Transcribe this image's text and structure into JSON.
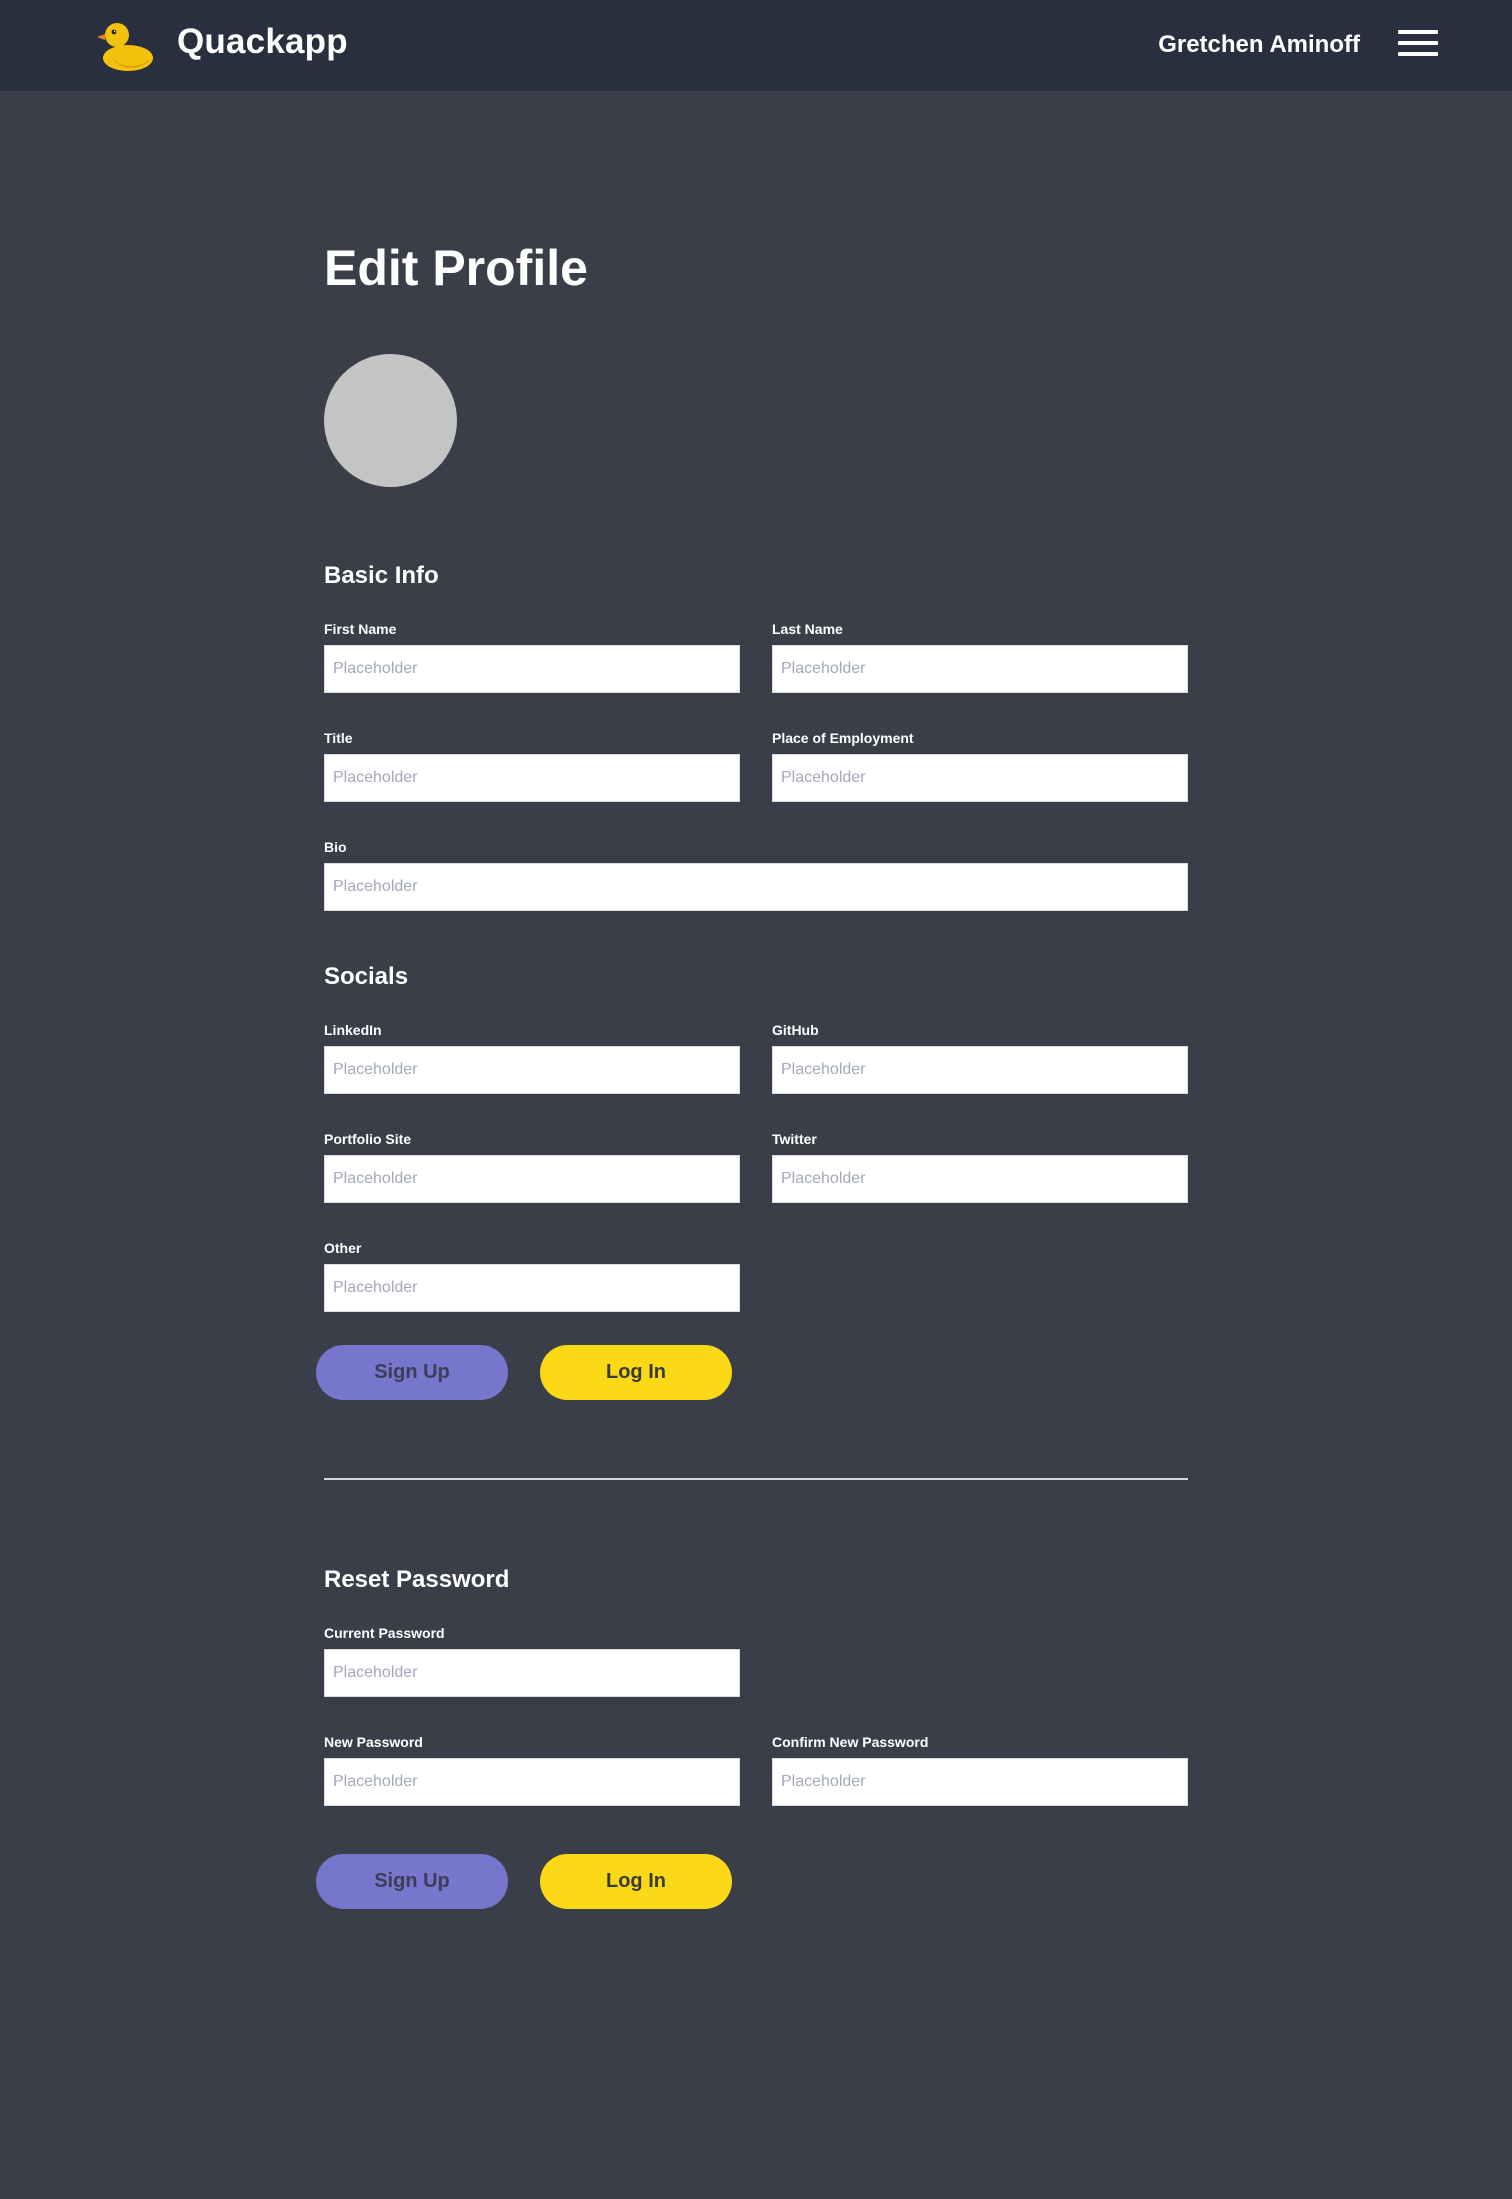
{
  "header": {
    "app_name": "Quackapp",
    "user_name": "Gretchen Aminoff",
    "logo_icon": "duck-icon",
    "menu_icon": "hamburger-menu-icon"
  },
  "page": {
    "title": "Edit Profile"
  },
  "basic_info": {
    "heading": "Basic Info",
    "first_name": {
      "label": "First Name",
      "placeholder": "Placeholder",
      "value": ""
    },
    "last_name": {
      "label": "Last Name",
      "placeholder": "Placeholder",
      "value": ""
    },
    "title": {
      "label": "Title",
      "placeholder": "Placeholder",
      "value": ""
    },
    "employment": {
      "label": "Place of Employment",
      "placeholder": "Placeholder",
      "value": ""
    },
    "bio": {
      "label": "Bio",
      "placeholder": "Placeholder",
      "value": ""
    }
  },
  "socials": {
    "heading": "Socials",
    "linkedin": {
      "label": "LinkedIn",
      "placeholder": "Placeholder",
      "value": ""
    },
    "github": {
      "label": "GitHub",
      "placeholder": "Placeholder",
      "value": ""
    },
    "portfolio": {
      "label": "Portfolio Site",
      "placeholder": "Placeholder",
      "value": ""
    },
    "twitter": {
      "label": "Twitter",
      "placeholder": "Placeholder",
      "value": ""
    },
    "other": {
      "label": "Other",
      "placeholder": "Placeholder",
      "value": ""
    }
  },
  "profile_actions": {
    "signup_label": "Sign Up",
    "login_label": "Log In"
  },
  "reset_password": {
    "heading": "Reset Password",
    "current": {
      "label": "Current Password",
      "placeholder": "Placeholder",
      "value": ""
    },
    "new": {
      "label": "New Password",
      "placeholder": "Placeholder",
      "value": ""
    },
    "confirm": {
      "label": "Confirm New Password",
      "placeholder": "Placeholder",
      "value": ""
    }
  },
  "password_actions": {
    "signup_label": "Sign Up",
    "login_label": "Log In"
  },
  "colors": {
    "page_background": "#3a3e49",
    "navbar_background": "#292f3e",
    "signup_button": "#7677cc",
    "login_button": "#fbd917",
    "avatar_placeholder": "#c4c4c4"
  }
}
